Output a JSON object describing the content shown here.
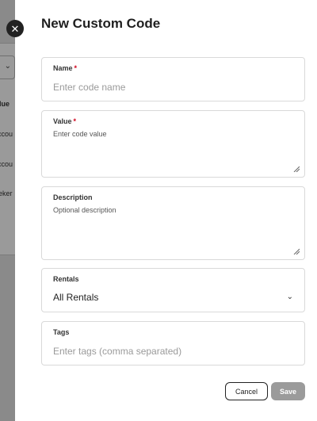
{
  "background": {
    "texts": [
      "lue",
      "ccou",
      "ccou",
      "eker"
    ]
  },
  "close": {
    "label": "✕"
  },
  "title": "New Custom Code",
  "form": {
    "name": {
      "label": "Name",
      "required_mark": "*",
      "placeholder": "Enter code name"
    },
    "value": {
      "label": "Value",
      "required_mark": "*",
      "placeholder": "Enter code value"
    },
    "description": {
      "label": "Description",
      "placeholder": "Optional description"
    },
    "rentals": {
      "label": "Rentals",
      "selected": "All Rentals"
    },
    "tags": {
      "label": "Tags",
      "placeholder": "Enter tags (comma separated)"
    }
  },
  "actions": {
    "cancel": "Cancel",
    "save": "Save"
  },
  "colors": {
    "save_disabled": "#9b9b9b",
    "required": "#d0021b",
    "overlay": "#8a8a8a"
  }
}
